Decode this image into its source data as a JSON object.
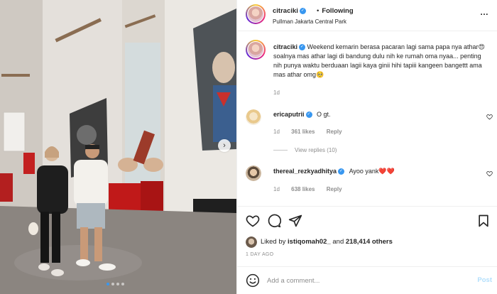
{
  "header": {
    "username": "citraciki",
    "separator": "•",
    "follow_status": "Following",
    "location": "Pullman Jakarta Central Park"
  },
  "caption": {
    "username": "citraciki",
    "text": "Weekend kemarin berasa pacaran lagi sama papa nya athar😍 soalnya mas athar lagi di bandung dulu nih ke rumah oma nyaa... penting nih punya waktu berduaan lagii kaya ginii hihi tapiii kangeen bangettt ama mas athar omg🥺",
    "time": "1d"
  },
  "comments": [
    {
      "username": "ericaputrii",
      "text": "O gt.",
      "time": "1d",
      "likes": "361 likes",
      "reply": "Reply"
    },
    {
      "username": "thereal_rezkyadhitya",
      "text": "Ayoo yank❤️❤️",
      "time": "1d",
      "likes": "638 likes",
      "reply": "Reply"
    }
  ],
  "view_replies": "View replies (10)",
  "likes": {
    "prefix": "Liked by ",
    "user": "istiqomah02_",
    "middle": " and ",
    "count": "218,414 others"
  },
  "date": "1 DAY AGO",
  "add_comment": {
    "placeholder": "Add a comment...",
    "post_label": "Post"
  },
  "media": {
    "slide_count": 4,
    "active_slide": 1
  },
  "colors": {
    "accent": "#3897f0",
    "heart": "#ed4956",
    "muted": "#8e8e8e"
  }
}
